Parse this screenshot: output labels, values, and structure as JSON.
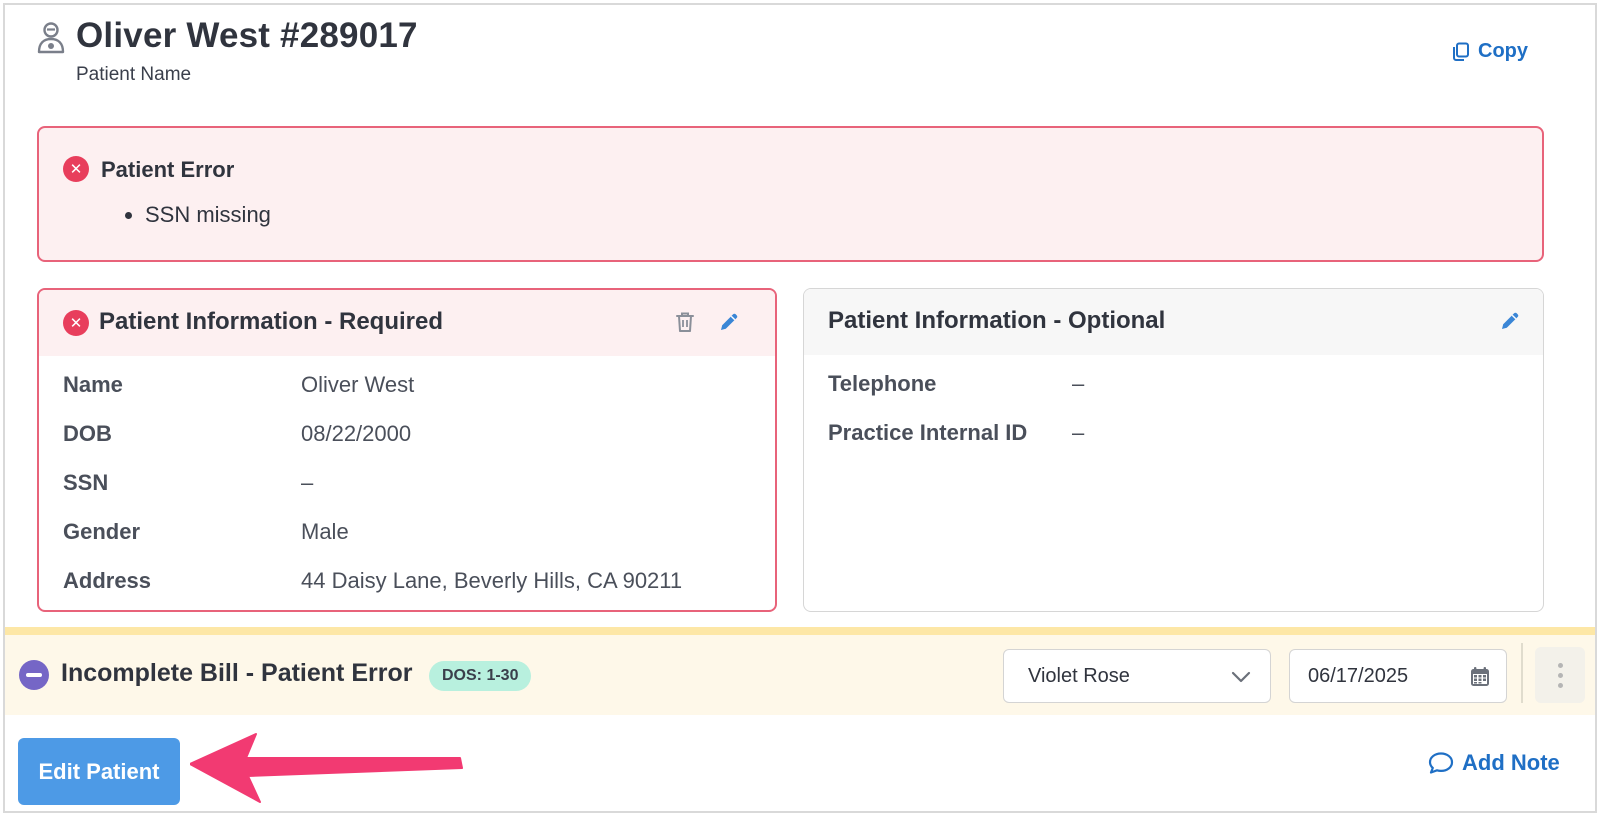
{
  "header": {
    "title": "Oliver West #289017",
    "subtitle": "Patient Name",
    "copy_label": "Copy",
    "icon": "patient-icon"
  },
  "alert": {
    "title": "Patient Error",
    "items": [
      "SSN missing"
    ],
    "icon": "error-x-icon",
    "color": "#e83e5c"
  },
  "required_card": {
    "title": "Patient Information - Required",
    "icons": [
      "error-x-icon",
      "trash-icon",
      "pencil-icon"
    ],
    "fields": [
      {
        "label": "Name",
        "value": "Oliver West"
      },
      {
        "label": "DOB",
        "value": "08/22/2000"
      },
      {
        "label": "SSN",
        "value": "–"
      },
      {
        "label": "Gender",
        "value": "Male"
      },
      {
        "label": "Address",
        "value": "44 Daisy Lane, Beverly Hills, CA 90211"
      }
    ]
  },
  "optional_card": {
    "title": "Patient Information - Optional",
    "icons": [
      "pencil-icon"
    ],
    "fields": [
      {
        "label": "Telephone",
        "value": "–"
      },
      {
        "label": "Practice Internal ID",
        "value": "–"
      }
    ]
  },
  "bill": {
    "title": "Incomplete Bill - Patient Error",
    "badge": "DOS: 1-30",
    "provider_select": "Violet Rose",
    "date": "06/17/2025",
    "status_color": "#7566c6",
    "badge_color": "#b8f0de"
  },
  "footer": {
    "edit_label": "Edit Patient",
    "add_note_label": "Add Note",
    "accent": "#4d9ae6",
    "link_color": "#1f6fc5"
  }
}
